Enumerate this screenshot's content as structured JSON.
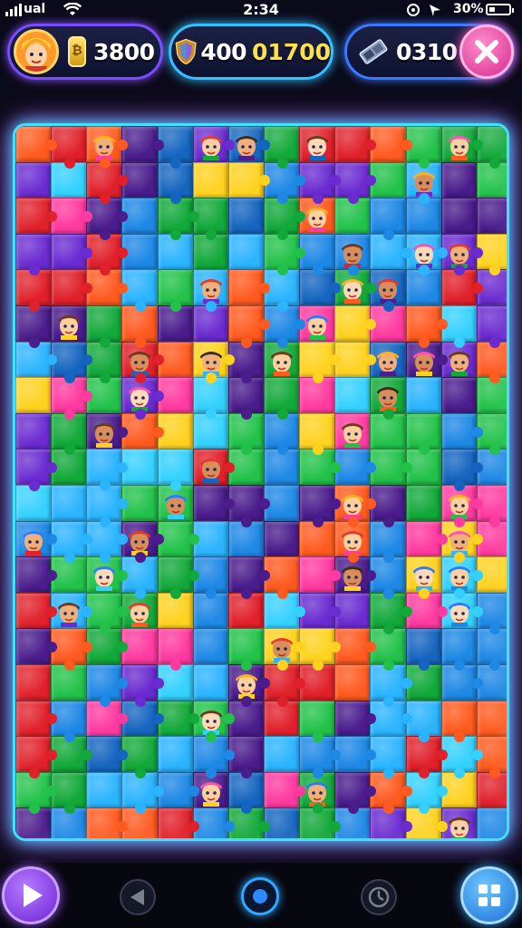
{
  "status_bar": {
    "carrier": "ual",
    "time": "2:34",
    "battery": "30%",
    "battery_level": 0.3
  },
  "hud": {
    "coins": "3800",
    "shield_value": "400",
    "shield_bonus": "01700",
    "gems": "0310"
  },
  "board": {
    "rows": 20,
    "cols": 14,
    "palette": [
      "#1e88e5",
      "#2bb4ff",
      "#22c24a",
      "#4a1c8c",
      "#ff5a1f",
      "#e0202a",
      "#6a2bd0",
      "#34d1ff",
      "#ffd21f",
      "#ff3aa0",
      "#1565c0",
      "#12a83a"
    ],
    "character_tiles": [
      [
        0,
        2
      ],
      [
        0,
        5
      ],
      [
        0,
        6
      ],
      [
        0,
        8
      ],
      [
        0,
        12
      ],
      [
        1,
        11
      ],
      [
        2,
        8
      ],
      [
        3,
        9
      ],
      [
        3,
        11
      ],
      [
        3,
        12
      ],
      [
        4,
        5
      ],
      [
        4,
        9
      ],
      [
        4,
        10
      ],
      [
        5,
        1
      ],
      [
        5,
        8
      ],
      [
        6,
        3
      ],
      [
        6,
        5
      ],
      [
        6,
        7
      ],
      [
        6,
        10
      ],
      [
        6,
        11
      ],
      [
        6,
        12
      ],
      [
        7,
        3
      ],
      [
        7,
        10
      ],
      [
        8,
        2
      ],
      [
        8,
        9
      ],
      [
        9,
        5
      ],
      [
        10,
        4
      ],
      [
        10,
        9
      ],
      [
        10,
        12
      ],
      [
        11,
        0
      ],
      [
        11,
        3
      ],
      [
        11,
        9
      ],
      [
        11,
        12
      ],
      [
        12,
        2
      ],
      [
        12,
        9
      ],
      [
        12,
        11
      ],
      [
        12,
        12
      ],
      [
        13,
        1
      ],
      [
        13,
        3
      ],
      [
        13,
        12
      ],
      [
        14,
        7
      ],
      [
        15,
        6
      ],
      [
        16,
        5
      ],
      [
        18,
        5
      ],
      [
        18,
        8
      ],
      [
        19,
        12
      ]
    ]
  }
}
